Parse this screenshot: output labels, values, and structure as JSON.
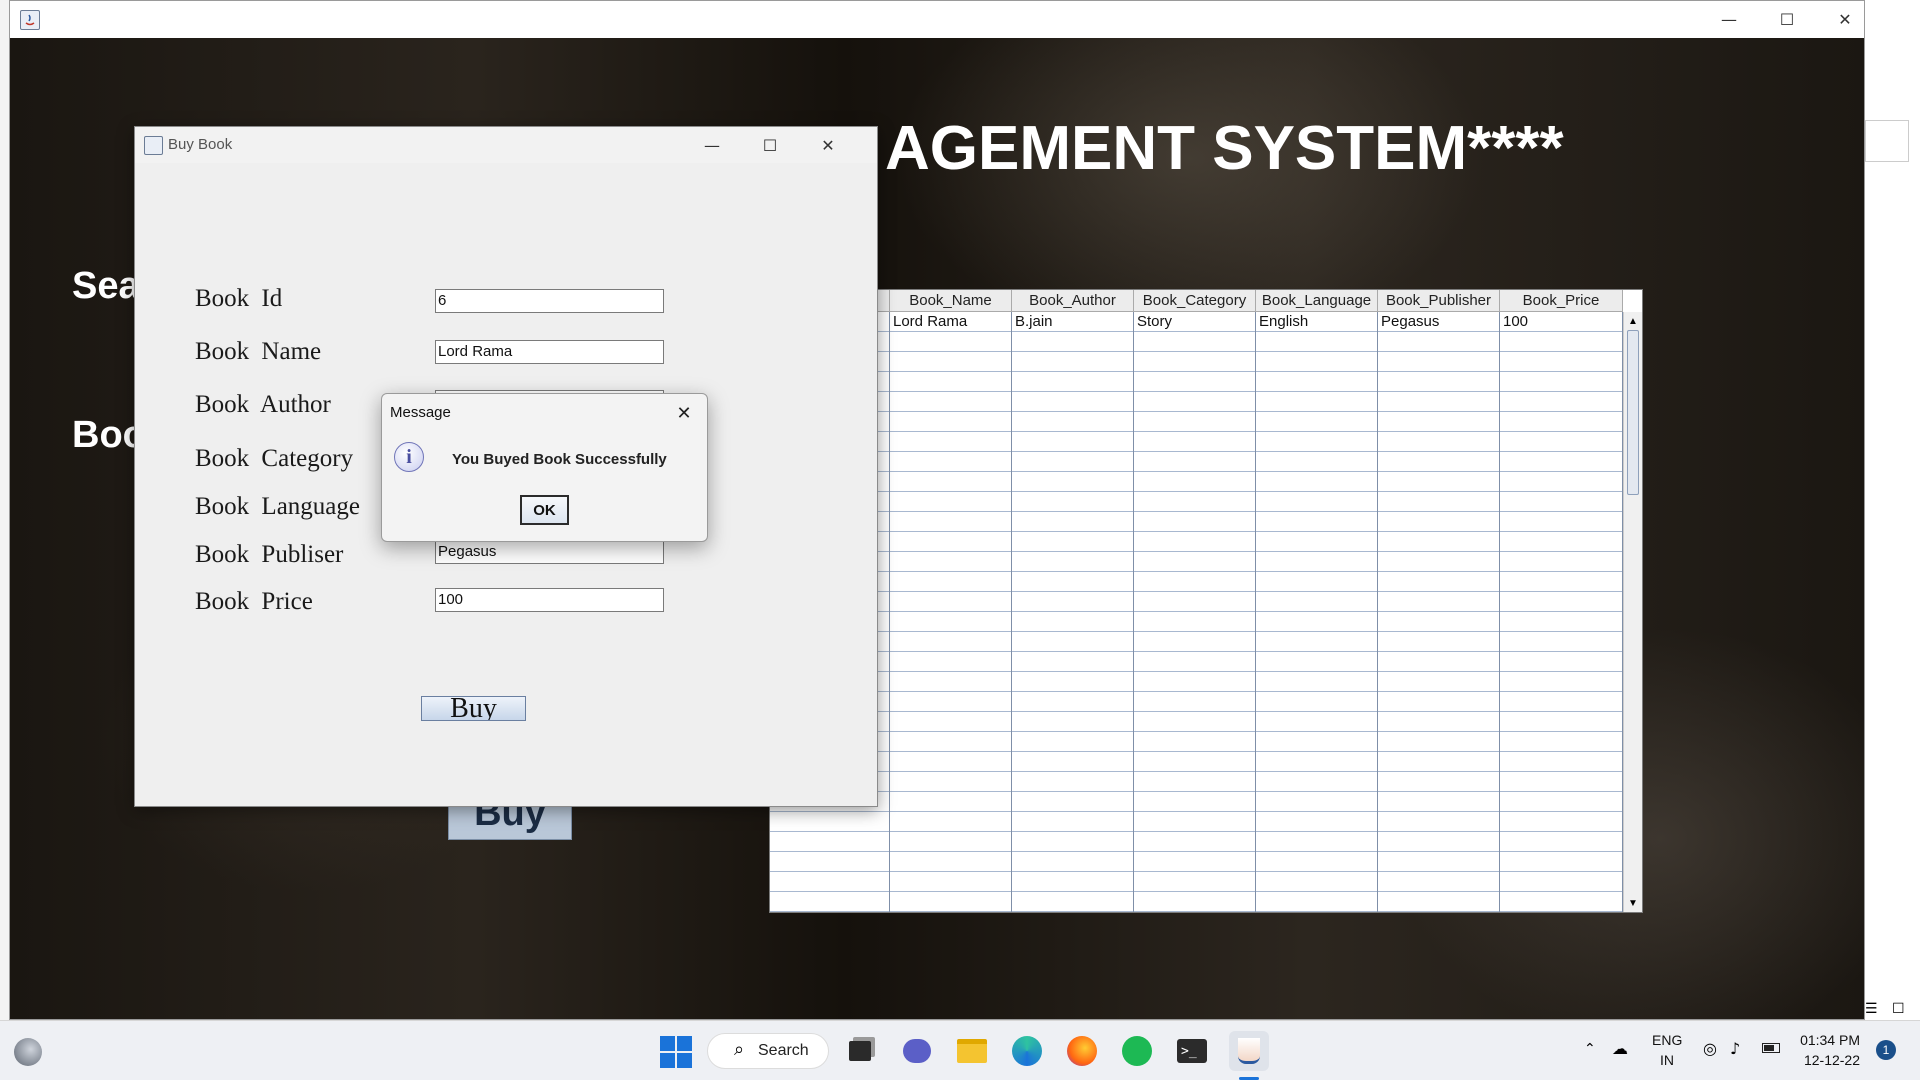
{
  "main_window": {
    "title": "",
    "banner_title": "AGEMENT SYSTEM****",
    "left_label_1": "Sea",
    "left_label_2": "Boo",
    "buy_label": "Buy",
    "controls": {
      "minimize": "—",
      "maximize": "☐",
      "close": "✕"
    }
  },
  "table": {
    "columns": [
      "Book_Name",
      "Book_Author",
      "Book_Category",
      "Book_Language",
      "Book_Publisher",
      "Book_Price"
    ],
    "rows": [
      [
        "Lord Rama",
        "B.jain",
        "Story",
        "English",
        "Pegasus",
        "100"
      ]
    ]
  },
  "buy_window": {
    "title": "Buy Book",
    "fields": [
      {
        "label": "Book  Id",
        "value": "6"
      },
      {
        "label": "Book  Name",
        "value": "Lord Rama"
      },
      {
        "label": "Book  Author",
        "value": ""
      },
      {
        "label": "Book  Category",
        "value": ""
      },
      {
        "label": "Book  Language",
        "value": ""
      },
      {
        "label": "Book  Publiser",
        "value": "Pegasus"
      },
      {
        "label": "Book  Price",
        "value": "100"
      }
    ],
    "buy_button": "Buy",
    "controls": {
      "minimize": "—",
      "maximize": "☐",
      "close": "✕"
    }
  },
  "message": {
    "title": "Message",
    "text": "You Buyed Book Successfully",
    "ok": "OK",
    "icon_glyph": "i"
  },
  "taskbar": {
    "search_label": "Search",
    "language": "ENG",
    "region": "IN",
    "time": "01:34 PM",
    "date": "12-12-22",
    "notification_count": "1"
  },
  "icons": [
    "java-app-icon",
    "search-icon",
    "windows-start-icon",
    "task-view-icon",
    "chat-icon",
    "file-explorer-icon",
    "edge-icon",
    "firefox-icon",
    "spotify-icon",
    "terminal-icon",
    "java-icon",
    "info-icon",
    "close-icon"
  ]
}
